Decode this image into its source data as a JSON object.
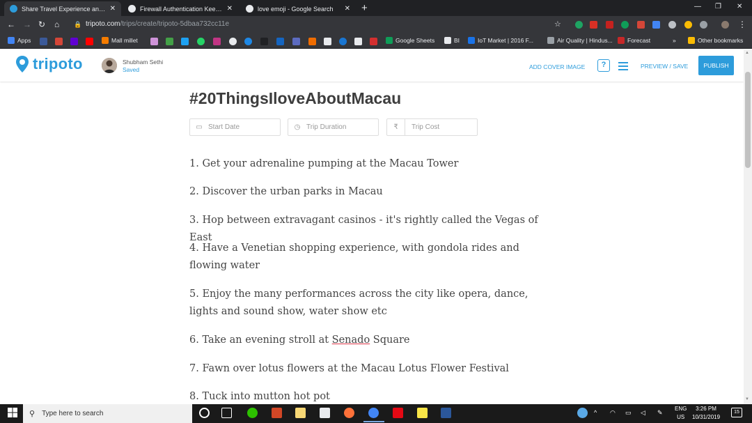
{
  "browser": {
    "tabs": [
      {
        "title": "Share Travel Experience and Stori",
        "active": true,
        "fav_color": "#2d9cdb"
      },
      {
        "title": "Firewall Authentication Keepalive",
        "active": false,
        "fav_color": "#e8eaed"
      },
      {
        "title": "love emoji - Google Search",
        "active": false,
        "fav_color": "#e8eaed"
      }
    ],
    "new_tab": "+",
    "url_host": "tripoto.com",
    "url_path": "/trips/create/tripoto-5dbaa732cc11e",
    "bookmarks": {
      "apps": "Apps",
      "mall_millet": "Mall millet",
      "google_sheets": "Google Sheets",
      "bi": "BI",
      "iot_market": "IoT Market | 2016 F...",
      "air_quality": "Air Quality | Hindus...",
      "forecast": "Forecast",
      "more": "»",
      "other": "Other bookmarks"
    }
  },
  "app": {
    "logo": "tripoto",
    "user_name": "Shubham Sethi",
    "status": "Saved",
    "add_cover": "ADD COVER IMAGE",
    "help": "?",
    "preview": "PREVIEW / SAVE",
    "publish": "PUBLISH",
    "colors": {
      "accent": "#2d9cdb",
      "link_underline": "#e0394b"
    }
  },
  "trip": {
    "title": "#20ThingsIloveAboutMacau",
    "start_date_placeholder": "Start Date",
    "duration_placeholder": "Trip Duration",
    "cost_placeholder": "Trip Cost",
    "currency_symbol": "₹",
    "items": [
      "1. Get your adrenaline pumping at the Macau Tower",
      "2. Discover the urban parks in Macau",
      "3. Hop between extravagant casinos - it's rightly called the Vegas of East",
      "4. Have a Venetian shopping experience, with gondola rides and flowing water",
      "5. Enjoy the many performances across the city like opera, dance, lights and sound show, water show etc",
      "6. Take an evening stroll at ",
      "7. Fawn over lotus flowers at the Macau Lotus Flower Festival",
      "8. Tuck into mutton hot pot"
    ],
    "item6_link": "Senado",
    "item6_tail": " Square"
  },
  "taskbar": {
    "search_placeholder": "Type here to search",
    "lang_top": "ENG",
    "lang_bottom": "US",
    "time": "3:26 PM",
    "date": "10/31/2019",
    "notifications": "15"
  }
}
